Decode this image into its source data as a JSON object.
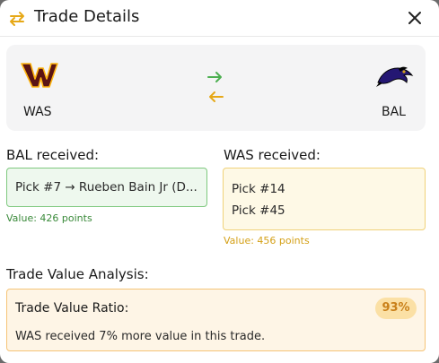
{
  "header": {
    "title": "Trade Details",
    "close_icon": "close-icon",
    "swap_icon": "swap-arrows-icon"
  },
  "teams": {
    "left": {
      "abbr": "WAS",
      "logo": "commanders-logo"
    },
    "right": {
      "abbr": "BAL",
      "logo": "ravens-logo"
    },
    "arrow_colors": {
      "right": "#4caf50",
      "left": "#e6a817"
    }
  },
  "bal_received": {
    "label": "BAL received:",
    "picks": [
      "Pick #7 → Rueben Bain Jr (D..."
    ],
    "value": "Value: 426 points"
  },
  "was_received": {
    "label": "WAS received:",
    "picks": [
      "Pick #14",
      "Pick #45"
    ],
    "value": "Value: 456 points"
  },
  "analysis": {
    "label": "Trade Value Analysis:",
    "ratio_label": "Trade Value Ratio:",
    "ratio_value": "93%",
    "summary": "WAS received 7% more value in this trade."
  },
  "colors": {
    "accent_orange": "#e6a817",
    "green": "#4caf50",
    "was_burgundy": "#5a1414",
    "was_gold": "#ffb612",
    "bal_purple": "#241773"
  }
}
